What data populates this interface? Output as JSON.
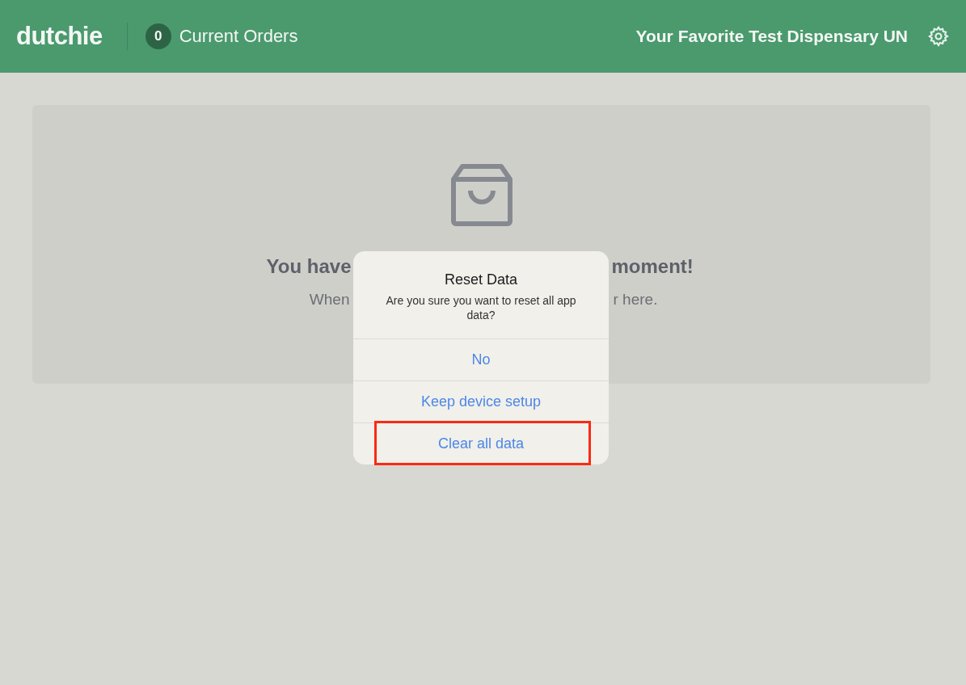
{
  "header": {
    "logo": "dutchie",
    "order_count": "0",
    "orders_label": "Current Orders",
    "store_name": "Your Favorite Test Dispensary UN"
  },
  "empty_state": {
    "heading_left": "You have",
    "heading_right": "moment!",
    "message_left": "When",
    "message_right": "r here."
  },
  "dialog": {
    "title": "Reset Data",
    "message": "Are you sure you want to reset all app data?",
    "actions": [
      {
        "label": "No",
        "highlighted": false
      },
      {
        "label": "Keep device setup",
        "highlighted": false
      },
      {
        "label": "Clear all data",
        "highlighted": true
      }
    ]
  }
}
